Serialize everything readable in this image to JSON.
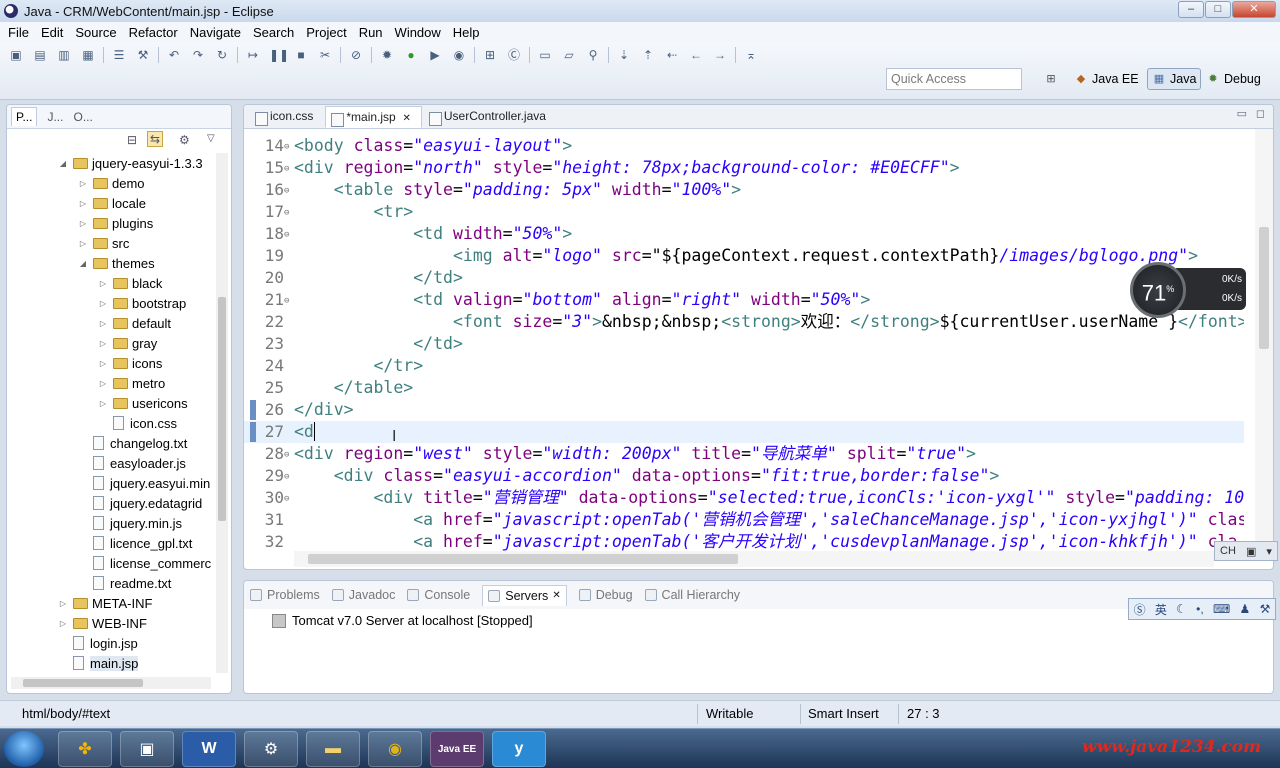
{
  "window": {
    "title": "Java - CRM/WebContent/main.jsp - Eclipse"
  },
  "menu": [
    "File",
    "Edit",
    "Source",
    "Refactor",
    "Navigate",
    "Search",
    "Project",
    "Run",
    "Window",
    "Help"
  ],
  "toolbar": {
    "quick_access_placeholder": "Quick Access",
    "perspectives": [
      "Java EE",
      "Java",
      "Debug"
    ]
  },
  "left_panel": {
    "tabs": [
      "P...",
      "J...",
      "O..."
    ],
    "tree": [
      {
        "label": "jquery-easyui-1.3.3",
        "kind": "folder",
        "depth": 0,
        "twisty": "open"
      },
      {
        "label": "demo",
        "kind": "folder",
        "depth": 1,
        "twisty": "closed"
      },
      {
        "label": "locale",
        "kind": "folder",
        "depth": 1,
        "twisty": "closed"
      },
      {
        "label": "plugins",
        "kind": "folder",
        "depth": 1,
        "twisty": "closed"
      },
      {
        "label": "src",
        "kind": "folder",
        "depth": 1,
        "twisty": "closed"
      },
      {
        "label": "themes",
        "kind": "folder",
        "depth": 1,
        "twisty": "open"
      },
      {
        "label": "black",
        "kind": "folder",
        "depth": 2,
        "twisty": "closed"
      },
      {
        "label": "bootstrap",
        "kind": "folder",
        "depth": 2,
        "twisty": "closed"
      },
      {
        "label": "default",
        "kind": "folder",
        "depth": 2,
        "twisty": "closed"
      },
      {
        "label": "gray",
        "kind": "folder",
        "depth": 2,
        "twisty": "closed"
      },
      {
        "label": "icons",
        "kind": "folder",
        "depth": 2,
        "twisty": "closed"
      },
      {
        "label": "metro",
        "kind": "folder",
        "depth": 2,
        "twisty": "closed"
      },
      {
        "label": "usericons",
        "kind": "folder",
        "depth": 2,
        "twisty": "closed"
      },
      {
        "label": "icon.css",
        "kind": "file",
        "depth": 2,
        "twisty": ""
      },
      {
        "label": "changelog.txt",
        "kind": "file",
        "depth": 1,
        "twisty": ""
      },
      {
        "label": "easyloader.js",
        "kind": "file",
        "depth": 1,
        "twisty": ""
      },
      {
        "label": "jquery.easyui.min",
        "kind": "file",
        "depth": 1,
        "twisty": ""
      },
      {
        "label": "jquery.edatagrid",
        "kind": "file",
        "depth": 1,
        "twisty": ""
      },
      {
        "label": "jquery.min.js",
        "kind": "file",
        "depth": 1,
        "twisty": ""
      },
      {
        "label": "licence_gpl.txt",
        "kind": "file",
        "depth": 1,
        "twisty": ""
      },
      {
        "label": "license_commerc",
        "kind": "file",
        "depth": 1,
        "twisty": ""
      },
      {
        "label": "readme.txt",
        "kind": "file",
        "depth": 1,
        "twisty": ""
      },
      {
        "label": "META-INF",
        "kind": "folder",
        "depth": 0,
        "twisty": "closed"
      },
      {
        "label": "WEB-INF",
        "kind": "folder",
        "depth": 0,
        "twisty": "closed"
      },
      {
        "label": "login.jsp",
        "kind": "file",
        "depth": 0,
        "twisty": ""
      },
      {
        "label": "main.jsp",
        "kind": "file",
        "depth": 0,
        "twisty": "",
        "selected": true
      }
    ]
  },
  "editor": {
    "tabs": [
      {
        "label": "icon.css",
        "active": false
      },
      {
        "label": "*main.jsp",
        "active": true
      },
      {
        "label": "UserController.java",
        "active": false
      }
    ],
    "lines": [
      {
        "n": "14",
        "fold": "⊖",
        "mark": false,
        "current": false,
        "tokens": [
          [
            "tag",
            "<body "
          ],
          [
            "attr",
            "class"
          ],
          [
            "txt",
            "="
          ],
          [
            "val",
            "\"easyui-layout\""
          ],
          [
            "tag",
            ">"
          ]
        ]
      },
      {
        "n": "15",
        "fold": "⊖",
        "mark": false,
        "current": false,
        "tokens": [
          [
            "tag",
            "<div "
          ],
          [
            "attr",
            "region"
          ],
          [
            "txt",
            "="
          ],
          [
            "val",
            "\"north\""
          ],
          [
            "txt",
            " "
          ],
          [
            "attr",
            "style"
          ],
          [
            "txt",
            "="
          ],
          [
            "val",
            "\"height: 78px;background-color: #E0ECFF\""
          ],
          [
            "tag",
            ">"
          ]
        ]
      },
      {
        "n": "16",
        "fold": "⊖",
        "mark": false,
        "current": false,
        "tokens": [
          [
            "txt",
            "    "
          ],
          [
            "tag",
            "<table "
          ],
          [
            "attr",
            "style"
          ],
          [
            "txt",
            "="
          ],
          [
            "val",
            "\"padding: 5px\""
          ],
          [
            "txt",
            " "
          ],
          [
            "attr",
            "width"
          ],
          [
            "txt",
            "="
          ],
          [
            "val",
            "\"100%\""
          ],
          [
            "tag",
            ">"
          ]
        ]
      },
      {
        "n": "17",
        "fold": "⊖",
        "mark": false,
        "current": false,
        "tokens": [
          [
            "txt",
            "        "
          ],
          [
            "tag",
            "<tr>"
          ]
        ]
      },
      {
        "n": "18",
        "fold": "⊖",
        "mark": false,
        "current": false,
        "tokens": [
          [
            "txt",
            "            "
          ],
          [
            "tag",
            "<td "
          ],
          [
            "attr",
            "width"
          ],
          [
            "txt",
            "="
          ],
          [
            "val",
            "\"50%\""
          ],
          [
            "tag",
            ">"
          ]
        ]
      },
      {
        "n": "19",
        "fold": "",
        "mark": false,
        "current": false,
        "tokens": [
          [
            "txt",
            "                "
          ],
          [
            "tag",
            "<img "
          ],
          [
            "attr",
            "alt"
          ],
          [
            "txt",
            "="
          ],
          [
            "val",
            "\"logo\""
          ],
          [
            "txt",
            " "
          ],
          [
            "attr",
            "src"
          ],
          [
            "txt",
            "=\"${pageContext.request.contextPath}"
          ],
          [
            "val",
            "/images/bglogo.png\""
          ],
          [
            "tag",
            ">"
          ]
        ]
      },
      {
        "n": "20",
        "fold": "",
        "mark": false,
        "current": false,
        "tokens": [
          [
            "txt",
            "            "
          ],
          [
            "tag",
            "</td>"
          ]
        ]
      },
      {
        "n": "21",
        "fold": "⊖",
        "mark": false,
        "current": false,
        "tokens": [
          [
            "txt",
            "            "
          ],
          [
            "tag",
            "<td "
          ],
          [
            "attr",
            "valign"
          ],
          [
            "txt",
            "="
          ],
          [
            "val",
            "\"bottom\""
          ],
          [
            "txt",
            " "
          ],
          [
            "attr",
            "align"
          ],
          [
            "txt",
            "="
          ],
          [
            "val",
            "\"right\""
          ],
          [
            "txt",
            " "
          ],
          [
            "attr",
            "width"
          ],
          [
            "txt",
            "="
          ],
          [
            "val",
            "\"50%\""
          ],
          [
            "tag",
            ">"
          ]
        ]
      },
      {
        "n": "22",
        "fold": "",
        "mark": false,
        "current": false,
        "tokens": [
          [
            "txt",
            "                "
          ],
          [
            "tag",
            "<font "
          ],
          [
            "attr",
            "size"
          ],
          [
            "txt",
            "="
          ],
          [
            "val",
            "\"3\""
          ],
          [
            "tag",
            ">"
          ],
          [
            "txt",
            "&nbsp;&nbsp;"
          ],
          [
            "tag",
            "<strong>"
          ],
          [
            "txt",
            "欢迎："
          ],
          [
            "tag",
            "</strong>"
          ],
          [
            "txt",
            "${currentUser.userName }"
          ],
          [
            "tag",
            "</font>"
          ]
        ]
      },
      {
        "n": "23",
        "fold": "",
        "mark": false,
        "current": false,
        "tokens": [
          [
            "txt",
            "            "
          ],
          [
            "tag",
            "</td>"
          ]
        ]
      },
      {
        "n": "24",
        "fold": "",
        "mark": false,
        "current": false,
        "tokens": [
          [
            "txt",
            "        "
          ],
          [
            "tag",
            "</tr>"
          ]
        ]
      },
      {
        "n": "25",
        "fold": "",
        "mark": false,
        "current": false,
        "tokens": [
          [
            "txt",
            "    "
          ],
          [
            "tag",
            "</table>"
          ]
        ]
      },
      {
        "n": "26",
        "fold": "",
        "mark": true,
        "current": false,
        "tokens": [
          [
            "tag",
            "</div>"
          ]
        ]
      },
      {
        "n": "27",
        "fold": "",
        "mark": true,
        "current": true,
        "tokens": [
          [
            "tag",
            "<d"
          ]
        ]
      },
      {
        "n": "28",
        "fold": "⊖",
        "mark": false,
        "current": false,
        "tokens": [
          [
            "tag",
            "<div "
          ],
          [
            "attr",
            "region"
          ],
          [
            "txt",
            "="
          ],
          [
            "val",
            "\"west\""
          ],
          [
            "txt",
            " "
          ],
          [
            "attr",
            "style"
          ],
          [
            "txt",
            "="
          ],
          [
            "val",
            "\"width: 200px\""
          ],
          [
            "txt",
            " "
          ],
          [
            "attr",
            "title"
          ],
          [
            "txt",
            "="
          ],
          [
            "val",
            "\"导航菜单\""
          ],
          [
            "txt",
            " "
          ],
          [
            "attr",
            "split"
          ],
          [
            "txt",
            "="
          ],
          [
            "val",
            "\"true\""
          ],
          [
            "tag",
            ">"
          ]
        ]
      },
      {
        "n": "29",
        "fold": "⊖",
        "mark": false,
        "current": false,
        "tokens": [
          [
            "txt",
            "    "
          ],
          [
            "tag",
            "<div "
          ],
          [
            "attr",
            "class"
          ],
          [
            "txt",
            "="
          ],
          [
            "val",
            "\"easyui-accordion\""
          ],
          [
            "txt",
            " "
          ],
          [
            "attr",
            "data-options"
          ],
          [
            "txt",
            "="
          ],
          [
            "val",
            "\"fit:true,border:false\""
          ],
          [
            "tag",
            ">"
          ]
        ]
      },
      {
        "n": "30",
        "fold": "⊖",
        "mark": false,
        "current": false,
        "tokens": [
          [
            "txt",
            "        "
          ],
          [
            "tag",
            "<div "
          ],
          [
            "attr",
            "title"
          ],
          [
            "txt",
            "="
          ],
          [
            "val",
            "\"营销管理\""
          ],
          [
            "txt",
            " "
          ],
          [
            "attr",
            "data-options"
          ],
          [
            "txt",
            "="
          ],
          [
            "val",
            "\"selected:true,iconCls:'icon-yxgl'\""
          ],
          [
            "txt",
            " "
          ],
          [
            "attr",
            "style"
          ],
          [
            "txt",
            "="
          ],
          [
            "val",
            "\"padding: 10"
          ]
        ]
      },
      {
        "n": "31",
        "fold": "",
        "mark": false,
        "current": false,
        "tokens": [
          [
            "txt",
            "            "
          ],
          [
            "tag",
            "<a "
          ],
          [
            "attr",
            "href"
          ],
          [
            "txt",
            "="
          ],
          [
            "val",
            "\"javascript:openTab('营销机会管理','saleChanceManage.jsp','icon-yxjhgl')\""
          ],
          [
            "txt",
            " "
          ],
          [
            "attr",
            "clas"
          ]
        ]
      },
      {
        "n": "32",
        "fold": "",
        "mark": false,
        "current": false,
        "tokens": [
          [
            "txt",
            "            "
          ],
          [
            "tag",
            "<a "
          ],
          [
            "attr",
            "href"
          ],
          [
            "txt",
            "="
          ],
          [
            "val",
            "\"javascript:openTab('客户开发计划','cusdevplanManage.jsp','icon-khkfjh')\""
          ],
          [
            "txt",
            " "
          ],
          [
            "attr",
            "cla"
          ]
        ]
      }
    ]
  },
  "speed_widget": {
    "percent": "71",
    "percent_sign": "%",
    "up": "0K/s",
    "down": "0K/s"
  },
  "ime": {
    "ch_label": "CH",
    "lang": "英"
  },
  "bottom_panel": {
    "tabs": [
      {
        "label": "Problems",
        "active": false
      },
      {
        "label": "Javadoc",
        "active": false
      },
      {
        "label": "Console",
        "active": false
      },
      {
        "label": "Servers",
        "active": true
      },
      {
        "label": "Debug",
        "active": false
      },
      {
        "label": "Call Hierarchy",
        "active": false
      }
    ],
    "server": "Tomcat v7.0 Server at localhost  [Stopped]"
  },
  "status": {
    "path": "html/body/#text",
    "mode": "Writable",
    "insert": "Smart Insert",
    "position": "27 : 3"
  },
  "taskbar": {
    "apps": [
      "",
      "",
      "W",
      "",
      "",
      "",
      "Java EE",
      "y"
    ],
    "watermark": "www.java1234.com"
  }
}
